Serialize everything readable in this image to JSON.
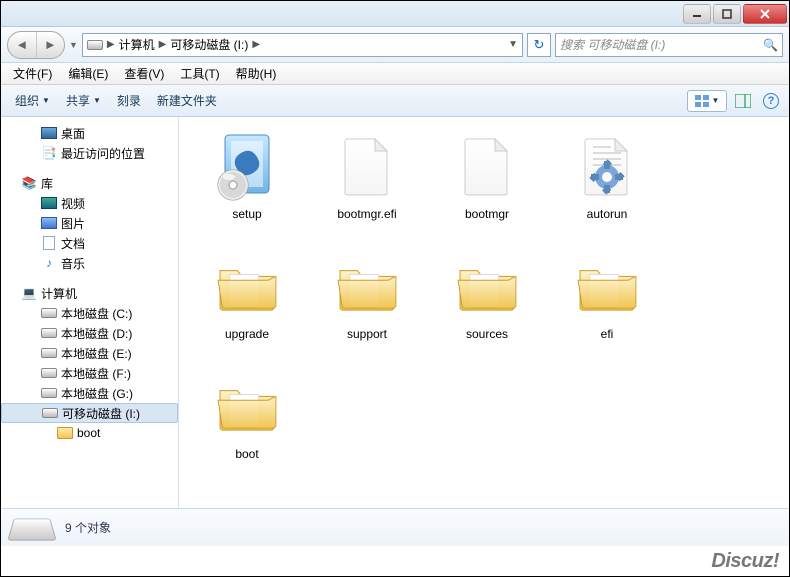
{
  "titlebar": {},
  "nav": {
    "crumb_root_label": "计算机",
    "crumb_current_label": "可移动磁盘 (I:)",
    "search_placeholder": "搜索 可移动磁盘 (I:)"
  },
  "menubar": {
    "file": "文件(F)",
    "edit": "编辑(E)",
    "view": "查看(V)",
    "tools": "工具(T)",
    "help": "帮助(H)"
  },
  "toolbar": {
    "organize": "组织",
    "share": "共享",
    "burn": "刻录",
    "new_folder": "新建文件夹"
  },
  "tree": {
    "desktop": "桌面",
    "recent": "最近访问的位置",
    "libraries": "库",
    "videos": "视频",
    "pictures": "图片",
    "documents": "文档",
    "music": "音乐",
    "computer": "计算机",
    "drive_c": "本地磁盘 (C:)",
    "drive_d": "本地磁盘 (D:)",
    "drive_e": "本地磁盘 (E:)",
    "drive_f": "本地磁盘 (F:)",
    "drive_g": "本地磁盘 (G:)",
    "drive_i": "可移动磁盘 (I:)",
    "boot_folder": "boot"
  },
  "items": [
    {
      "name": "setup",
      "type": "setup"
    },
    {
      "name": "bootmgr.efi",
      "type": "file"
    },
    {
      "name": "bootmgr",
      "type": "file"
    },
    {
      "name": "autorun",
      "type": "autorun"
    },
    {
      "name": "upgrade",
      "type": "folder"
    },
    {
      "name": "support",
      "type": "folder"
    },
    {
      "name": "sources",
      "type": "folder"
    },
    {
      "name": "efi",
      "type": "folder"
    },
    {
      "name": "boot",
      "type": "folder"
    }
  ],
  "status": {
    "count_text": "9 个对象"
  },
  "watermark": "Discuz!"
}
